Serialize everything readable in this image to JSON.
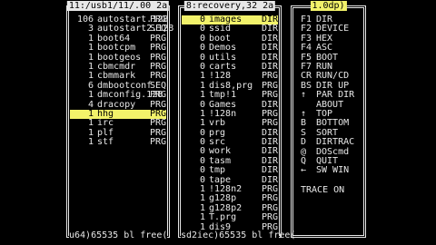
{
  "left_panel": {
    "title": "11:/usb1/11/.00 2a",
    "footer": "u64)65535 bl free(",
    "rows": [
      {
        "size": "106",
        "name": "autostart.128",
        "type": "PRG"
      },
      {
        "size": "3",
        "name": "autostart2.128",
        "type": "SEQ"
      },
      {
        "size": "1",
        "name": "boot64",
        "type": "PRG"
      },
      {
        "size": "1",
        "name": "bootcpm",
        "type": "PRG"
      },
      {
        "size": "1",
        "name": "bootgeos",
        "type": "PRG"
      },
      {
        "size": "1",
        "name": "cbmcmdr",
        "type": "PRG"
      },
      {
        "size": "1",
        "name": "cbmmark",
        "type": "PRG"
      },
      {
        "size": "6",
        "name": "dmbootconf",
        "type": "SEQ"
      },
      {
        "size": "1",
        "name": "dmconfig.128",
        "type": "PRG"
      },
      {
        "size": "4",
        "name": "dracopy",
        "type": "PRG"
      },
      {
        "size": "1",
        "name": "hhg",
        "type": "PRG"
      },
      {
        "size": "1",
        "name": "irc",
        "type": "PRG"
      },
      {
        "size": "1",
        "name": "plf",
        "type": "PRG"
      },
      {
        "size": "1",
        "name": "stf",
        "type": "PRG"
      }
    ],
    "selected_index": 10
  },
  "middle_panel": {
    "title": "8:recovery,32 2a",
    "footer": "sd2iec)65535 bl free(",
    "rows": [
      {
        "size": "0",
        "name": "images",
        "type": "DIR"
      },
      {
        "size": "0",
        "name": "ssid",
        "type": "DIR"
      },
      {
        "size": "0",
        "name": "boot",
        "type": "DIR"
      },
      {
        "size": "0",
        "name": "Demos",
        "type": "DIR"
      },
      {
        "size": "0",
        "name": "utils",
        "type": "DIR"
      },
      {
        "size": "0",
        "name": "carts",
        "type": "DIR"
      },
      {
        "size": "1",
        "name": "!128",
        "type": "PRG"
      },
      {
        "size": "1",
        "name": "dis8,prg",
        "type": "PRG"
      },
      {
        "size": "1",
        "name": "tmp!1",
        "type": "PRG"
      },
      {
        "size": "0",
        "name": "Games",
        "type": "DIR"
      },
      {
        "size": "1",
        "name": "!128n",
        "type": "PRG"
      },
      {
        "size": "1",
        "name": "vrb",
        "type": "PRG"
      },
      {
        "size": "0",
        "name": "prg",
        "type": "DIR"
      },
      {
        "size": "0",
        "name": "src",
        "type": "DIR"
      },
      {
        "size": "0",
        "name": "work",
        "type": "DIR"
      },
      {
        "size": "0",
        "name": "tasm",
        "type": "DIR"
      },
      {
        "size": "0",
        "name": "tmp",
        "type": "DIR"
      },
      {
        "size": "0",
        "name": "tape",
        "type": "DIR"
      },
      {
        "size": "1",
        "name": "!128n2",
        "type": "PRG"
      },
      {
        "size": "1",
        "name": "g128p",
        "type": "PRG"
      },
      {
        "size": "1",
        "name": "g128p2",
        "type": "PRG"
      },
      {
        "size": "1",
        "name": "T.prg",
        "type": "PRG"
      },
      {
        "size": "1",
        "name": "dis9",
        "type": "PRG"
      }
    ],
    "selected_index": 0
  },
  "menu": {
    "title": "1.0dp)",
    "items": [
      {
        "key": "F1",
        "label": "DIR"
      },
      {
        "key": "F2",
        "label": "DEVICE"
      },
      {
        "key": "F3",
        "label": "HEX"
      },
      {
        "key": "F4",
        "label": "ASC"
      },
      {
        "key": "F5",
        "label": "BOOT"
      },
      {
        "key": "F7",
        "label": "RUN"
      },
      {
        "key": "CR",
        "label": "RUN/CD"
      },
      {
        "key": "BS",
        "label": "DIR UP"
      },
      {
        "key": "↑",
        "label": "PAR DIR"
      },
      {
        "key": "",
        "label": "ABOUT"
      },
      {
        "key": "↑",
        "label": "TOP"
      },
      {
        "key": "B",
        "label": "BOTTOM"
      },
      {
        "key": "S",
        "label": "SORT"
      },
      {
        "key": "D",
        "label": "DIRTRAC"
      },
      {
        "key": "@",
        "label": "DOScmd"
      },
      {
        "key": "Q",
        "label": "QUIT"
      },
      {
        "key": "←",
        "label": "SW WIN"
      }
    ],
    "trace": "TRACE ON"
  }
}
